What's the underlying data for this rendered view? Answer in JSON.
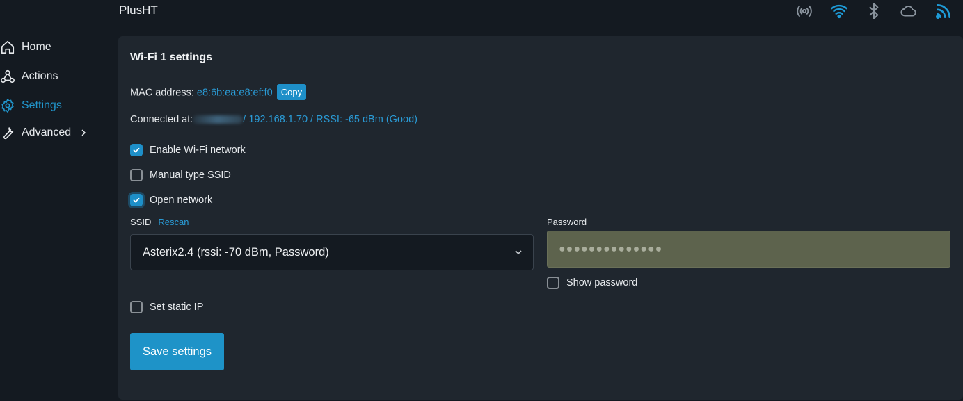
{
  "app": {
    "title": "PlusHT"
  },
  "status_icons": [
    "broadcast-icon",
    "wifi-icon",
    "bluetooth-icon",
    "cloud-icon",
    "signal-icon"
  ],
  "colors": {
    "accent": "#1e8fc8",
    "background": "#141a21",
    "panel": "#1f262e"
  },
  "sidebar": {
    "items": [
      {
        "label": "Home",
        "icon": "home-icon"
      },
      {
        "label": "Actions",
        "icon": "webhook-icon"
      },
      {
        "label": "Settings",
        "icon": "gear-icon",
        "active": true
      },
      {
        "label": "Advanced",
        "icon": "wrench-icon"
      }
    ]
  },
  "panel": {
    "title": "Wi-Fi 1 settings",
    "mac_label": "MAC address: ",
    "mac_value": "e8:6b:ea:e8:ef:f0",
    "copy_label": "Copy",
    "connected_label": "Connected at:",
    "connected_value": "/ 192.168.1.70 / RSSI: -65 dBm (Good)",
    "checkboxes": {
      "enable_wifi": {
        "label": "Enable Wi-Fi network",
        "checked": true
      },
      "manual_ssid": {
        "label": "Manual type SSID",
        "checked": false
      },
      "open_network": {
        "label": "Open network",
        "checked": true
      },
      "show_password": {
        "label": "Show password",
        "checked": false
      },
      "static_ip": {
        "label": "Set static IP",
        "checked": false
      }
    },
    "ssid_label": "SSID",
    "rescan_label": "Rescan",
    "ssid_selected": "Asterix2.4 (rssi: -70 dBm, Password)",
    "password_label": "Password",
    "password_value": "●●●●●●●●●●●●●●",
    "save_label": "Save settings"
  }
}
